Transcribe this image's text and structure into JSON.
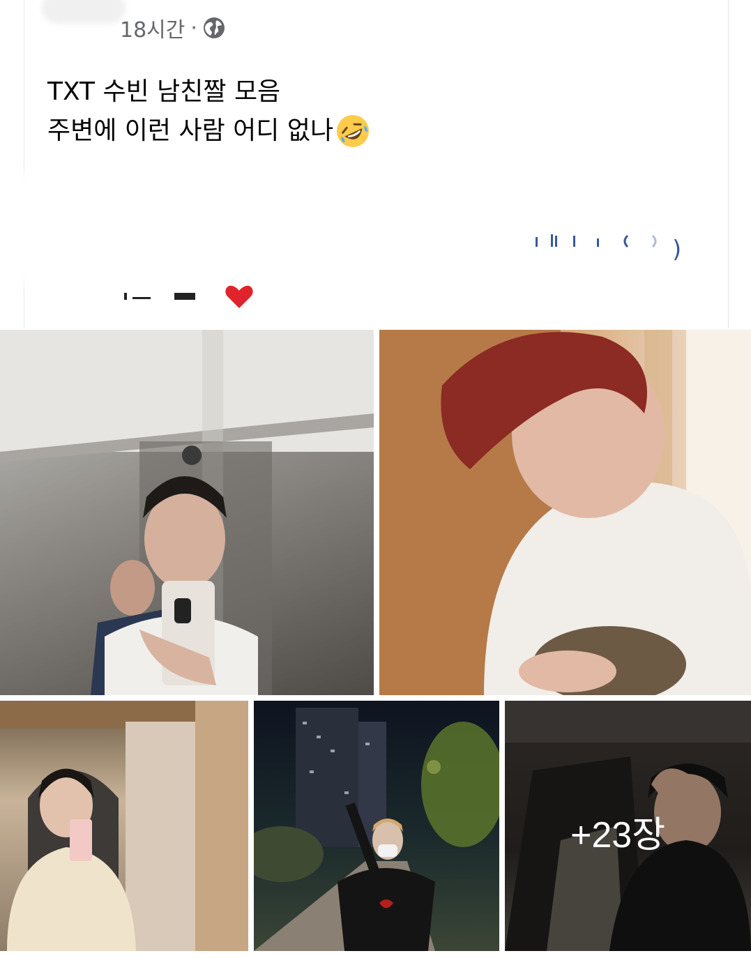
{
  "post": {
    "time": "18시간",
    "separator": "·",
    "privacy_icon": "globe-icon",
    "text_line1": "TXT 수빈 남친짤 모음",
    "text_line2": "주변에 이런 사람 어디 없나",
    "emoji": "rolling-on-floor-laughing",
    "closing_paren": ")"
  },
  "photos": {
    "count_shown": 5,
    "more_label": "+23장"
  },
  "colors": {
    "meta_text": "#65676b",
    "body_text": "#050505",
    "link": "#385898",
    "heart": "#e0242b"
  }
}
